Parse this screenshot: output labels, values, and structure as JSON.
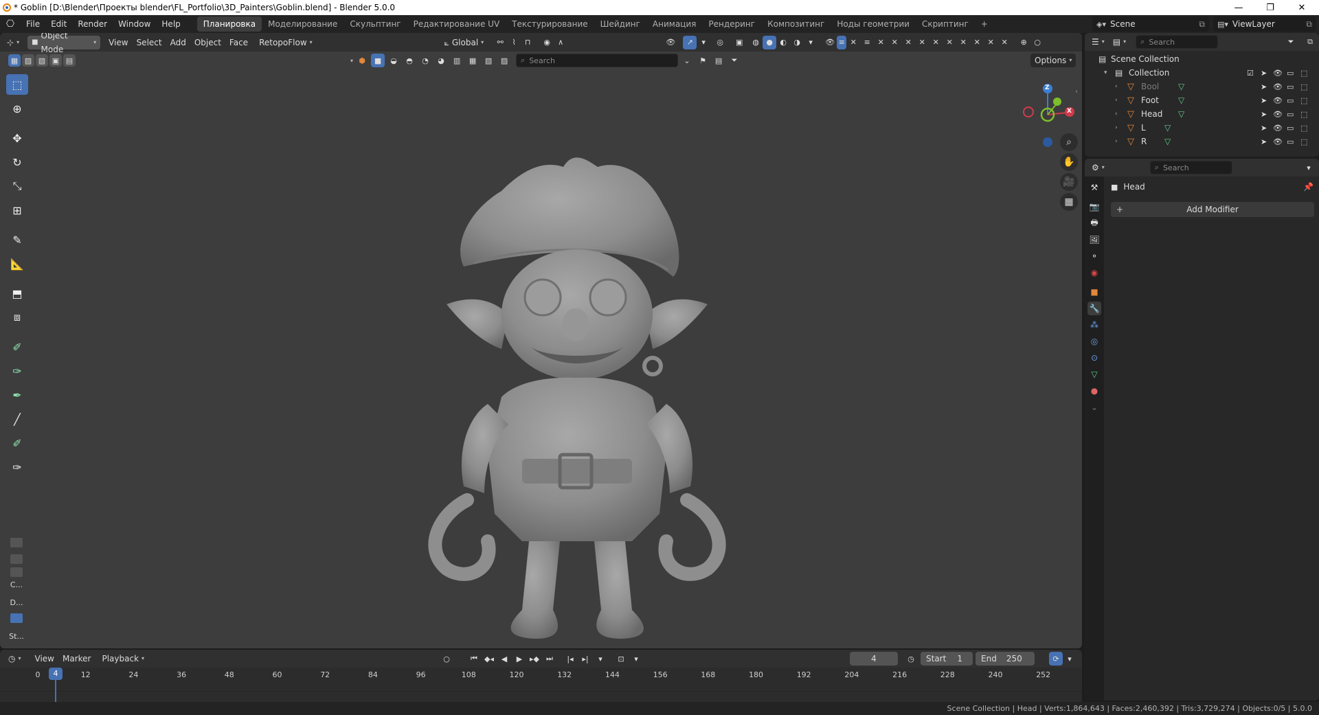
{
  "window": {
    "title": "* Goblin [D:\\Blender\\Проекты blender\\FL_Portfolio\\3D_Painters\\Goblin.blend] - Blender 5.0.0",
    "controls": [
      "—",
      "❐",
      "✕"
    ]
  },
  "menu": [
    "File",
    "Edit",
    "Render",
    "Window",
    "Help"
  ],
  "workspaces": {
    "active_index": 0,
    "tabs": [
      "Планировка",
      "Моделирование",
      "Скульптинг",
      "Редактирование UV",
      "Текстурирование",
      "Шейдинг",
      "Анимация",
      "Рендеринг",
      "Композитинг",
      "Ноды геометрии",
      "Скриптинг"
    ],
    "add": "+"
  },
  "scene": {
    "name": "Scene",
    "view_layer": "ViewLayer"
  },
  "viewport_header": {
    "mode": "Object Mode",
    "menus": [
      "View",
      "Select",
      "Add",
      "Object",
      "Face"
    ],
    "addon": "RetopoFlow",
    "orientation": "Global",
    "search_placeholder": "Search",
    "options": "Options"
  },
  "toolbar": {
    "tools": [
      "select-box-icon",
      "cursor-icon",
      "move-icon",
      "rotate-icon",
      "scale-icon",
      "transform-icon",
      "annotate-icon",
      "measure-icon",
      "add-cube-icon",
      "extrude-icon",
      "brush-draw-icon",
      "brush-inflate-icon",
      "brush-grab-icon",
      "brush-smooth-icon",
      "brush-mask-icon",
      "brush-snake-icon"
    ],
    "panel_labels": [
      "C...",
      "D...",
      "St...",
      "St..."
    ]
  },
  "gizmo": {
    "z": "Z",
    "x": "X",
    "y": "Y"
  },
  "timeline": {
    "menus": [
      "View",
      "Marker",
      "Playback"
    ],
    "current_frame": "4",
    "start_label": "Start",
    "start": "1",
    "end_label": "End",
    "end": "250",
    "ticks": [
      "0",
      "12",
      "24",
      "36",
      "48",
      "60",
      "72",
      "84",
      "96",
      "108",
      "120",
      "132",
      "144",
      "156",
      "168",
      "180",
      "192",
      "204",
      "216",
      "228",
      "240",
      "252"
    ]
  },
  "outliner": {
    "search_placeholder": "Search",
    "root": "Scene Collection",
    "collection": "Collection",
    "objects": [
      {
        "name": "Bool",
        "dim": true
      },
      {
        "name": "Foot",
        "dim": false
      },
      {
        "name": "Head",
        "dim": false
      },
      {
        "name": "L",
        "dim": false
      },
      {
        "name": "R",
        "dim": false
      }
    ]
  },
  "properties": {
    "search_placeholder": "Search",
    "object_name": "Head",
    "add_modifier": "Add Modifier"
  },
  "statusbar": {
    "text": "Scene Collection | Head | Verts:1,864,643 | Faces:2,460,392 | Tris:3,729,274 | Objects:0/5 | 5.0.0"
  },
  "colors": {
    "accent": "#4772b3",
    "viewport_bg": "#3d3d3d",
    "object_orange": "#e3873a",
    "mesh_green": "#5fcf8a",
    "axis_x": "#d33a4a",
    "axis_y": "#7fbf2a",
    "axis_z": "#3b7fd6"
  }
}
